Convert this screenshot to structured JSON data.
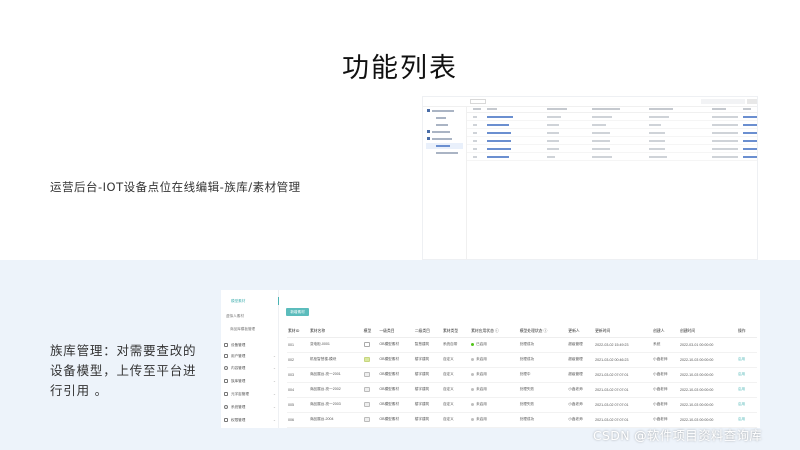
{
  "slide": {
    "title": "功能列表",
    "desc_top": "运营后台-IOT设备点位在线编辑-族库/素材管理",
    "desc_bottom": "族库管理：对需要查改的设备模型，上传至平台进行引用 。",
    "watermark": "CSDN @软件项目资料查询库"
  },
  "bottom_ui": {
    "sidebar_subitems": [
      "模型素材",
      "虚拟人素材",
      "商品库模板管理"
    ],
    "sidebar_items": [
      {
        "label": "设备管理",
        "icon": "device-icon"
      },
      {
        "label": "用户管理",
        "icon": "user-icon"
      },
      {
        "label": "内容管理",
        "icon": "content-icon"
      },
      {
        "label": "族库管理",
        "icon": "library-icon"
      },
      {
        "label": "元宇宙管理",
        "icon": "metaverse-icon"
      },
      {
        "label": "系统管理",
        "icon": "settings-icon"
      },
      {
        "label": "权限管理",
        "icon": "permission-icon"
      }
    ],
    "add_button": "新增素材",
    "columns": [
      "素材ID",
      "素材名称",
      "模型",
      "一级类目",
      "二级类目",
      "素材类型",
      "素材应用状态 ⓘ",
      "模型处理状态 ⓘ",
      "更新人",
      "更新时间",
      "创建人",
      "创建时间",
      "操作"
    ],
    "rows": [
      [
        "001",
        "变电柜-0001",
        "",
        "OB模型素材",
        "智慧建筑",
        "系统自带",
        "已启用",
        "处理成功",
        "超级管理",
        "2022-03-02 15:49:23",
        "系统",
        "2022-03-01 00:00:00",
        ""
      ],
      [
        "002",
        "机柜智慧楼-模块",
        "",
        "OB模型素材",
        "楼宇建筑",
        "自定义",
        "未启用",
        "处理成功",
        "超级管理",
        "2021-03-02 00:46:23",
        "小鑫老师",
        "2022-10-03 00:00:00",
        "启用"
      ],
      [
        "003",
        "商品展台-亮一2001",
        "",
        "OB模型素材",
        "楼宇建筑",
        "自定义",
        "未启用",
        "处理中",
        "超级管理",
        "2021-03-02 07:07:01",
        "小鑫老师",
        "2022-10-03 00:00:00",
        "启用"
      ],
      [
        "004",
        "商品展台-亮一2002",
        "",
        "OB模型素材",
        "楼宇建筑",
        "自定义",
        "未启用",
        "处理失败",
        "小鑫老师",
        "2021-03-02 07:07:01",
        "小鑫老师",
        "2022-10-03 00:00:00",
        "启用"
      ],
      [
        "005",
        "商品展台-亮一2003",
        "",
        "OB模型素材",
        "楼宇建筑",
        "自定义",
        "未启用",
        "处理失败",
        "小鑫老师",
        "2021-03-02 07:07:01",
        "小鑫老师",
        "2022-10-03 00:00:00",
        "启用"
      ],
      [
        "006",
        "商品展台-2004",
        "",
        "OB模型素材",
        "楼宇建筑",
        "自定义",
        "未启用",
        "处理成功",
        "小鑫老师",
        "2021-03-02 07:07:01",
        "小鑫老师",
        "2022-10-03 00:00:00",
        "启用"
      ]
    ],
    "status_colors": {
      "enabled": "#52c41a",
      "disabled": "#bfbfbf"
    }
  },
  "colors": {
    "accent": "#5bbcbc",
    "band": "#edf3fa"
  }
}
